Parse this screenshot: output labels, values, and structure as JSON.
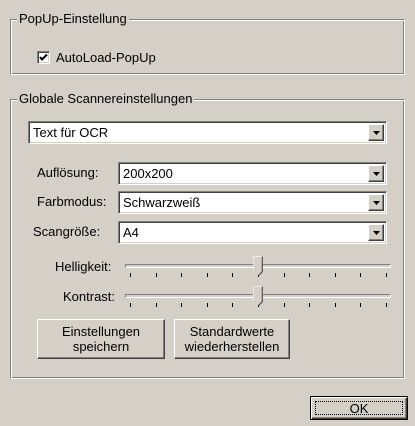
{
  "popup": {
    "group_title": "PopUp-Einstellung",
    "autoload_label": "AutoLoad-PopUp",
    "autoload_checked": true
  },
  "global": {
    "group_title": "Globale Scannereinstellungen",
    "mode_value": "Text für OCR",
    "resolution": {
      "label": "Auflösung:",
      "value": "200x200"
    },
    "color_mode": {
      "label": "Farbmodus:",
      "value": "Schwarzweiß"
    },
    "scan_size": {
      "label": "Scangröße:",
      "value": "A4"
    },
    "brightness": {
      "label": "Helligkeit:",
      "level": 0.5
    },
    "contrast": {
      "label": "Kontrast:",
      "level": 0.5
    },
    "save_button": {
      "line1": "Einstellungen",
      "line2": "speichern"
    },
    "defaults_button": {
      "line1": "Standardwerte",
      "line2": "wiederherstellen"
    }
  },
  "ok_button": "OK"
}
